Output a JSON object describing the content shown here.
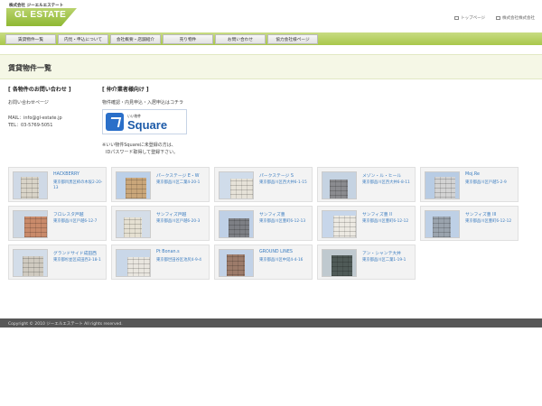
{
  "header": {
    "logo_company": "株式会社 ジーエルエステート",
    "logo_text": "GL ESTATE",
    "links": [
      {
        "label": "トップページ",
        "icon": "window-icon"
      },
      {
        "label": "株式会社株式会社",
        "icon": "window-icon"
      }
    ]
  },
  "nav": {
    "items": [
      {
        "label": "賃貸物件一覧"
      },
      {
        "label": "内見・申込について"
      },
      {
        "label": "会社概要・店舗紹介"
      },
      {
        "label": "売り物件"
      },
      {
        "label": "お問い合わせ"
      },
      {
        "label": "協力会社様ページ"
      }
    ]
  },
  "page": {
    "title": "賃貸物件一覧"
  },
  "contact": {
    "heading": "[ 各物件のお問い合わせ ]",
    "link": "お問い合わせページ",
    "mail": "MAIL：info@gl-estate.jp",
    "tel": "TEL：03-5769-5051"
  },
  "agents": {
    "heading": "[ 仲介業者様向け ]",
    "desc": "物件確認・内見申込・入居申込はコチラ",
    "square_small": "いい物件",
    "square_big": "Square",
    "note1": "※いい物件Squareに未登録の方は、",
    "note2": "IDパスワード取得して登録下さい。"
  },
  "properties": [
    {
      "name": "HACKBERRY",
      "addr": "東京都目黒区柿の木坂2-20-13"
    },
    {
      "name": "パークステージ E・W",
      "addr": "東京都品川区二葉4-20-1"
    },
    {
      "name": "パークステージ S",
      "addr": "東京都品川区西大井6-1-15"
    },
    {
      "name": "メゾン・ル・ヒール",
      "addr": "東京都品川区西大井6-8-11"
    },
    {
      "name": "Moj.Re",
      "addr": "東京都品川区戸越5-2-9"
    },
    {
      "name": "フロレスタ戸越",
      "addr": "東京都品川区戸越6-12-7"
    },
    {
      "name": "サンフィズ戸越",
      "addr": "東京都品川区戸越6-20-3"
    },
    {
      "name": "サンフィズ豊",
      "addr": "東京都品川区豊町6-12-13"
    },
    {
      "name": "サンフィズ豊 II",
      "addr": "東京都品川区豊町6-12-12"
    },
    {
      "name": "サンフィズ豊 III",
      "addr": "東京都品川区豊町6-12-12"
    },
    {
      "name": "グランドサイド成田西",
      "addr": "東京都杉並区成田西3-18-1"
    },
    {
      "name": "Pt Bonan.s",
      "addr": "東京都世田谷区池尻4-9-4"
    },
    {
      "name": "GROUND LINES",
      "addr": "東京都品川区中延4-4-16"
    },
    {
      "name": "アン・シャンテ大井",
      "addr": "東京都品川区二葉1-19-1"
    }
  ],
  "footer": {
    "copyright": "Copyright © 2010 ジーエルエステート All rights reserved."
  },
  "colors": {
    "accent_green": "#a8c74b",
    "link_blue": "#3a7cc0",
    "footer_bg": "#575757"
  }
}
